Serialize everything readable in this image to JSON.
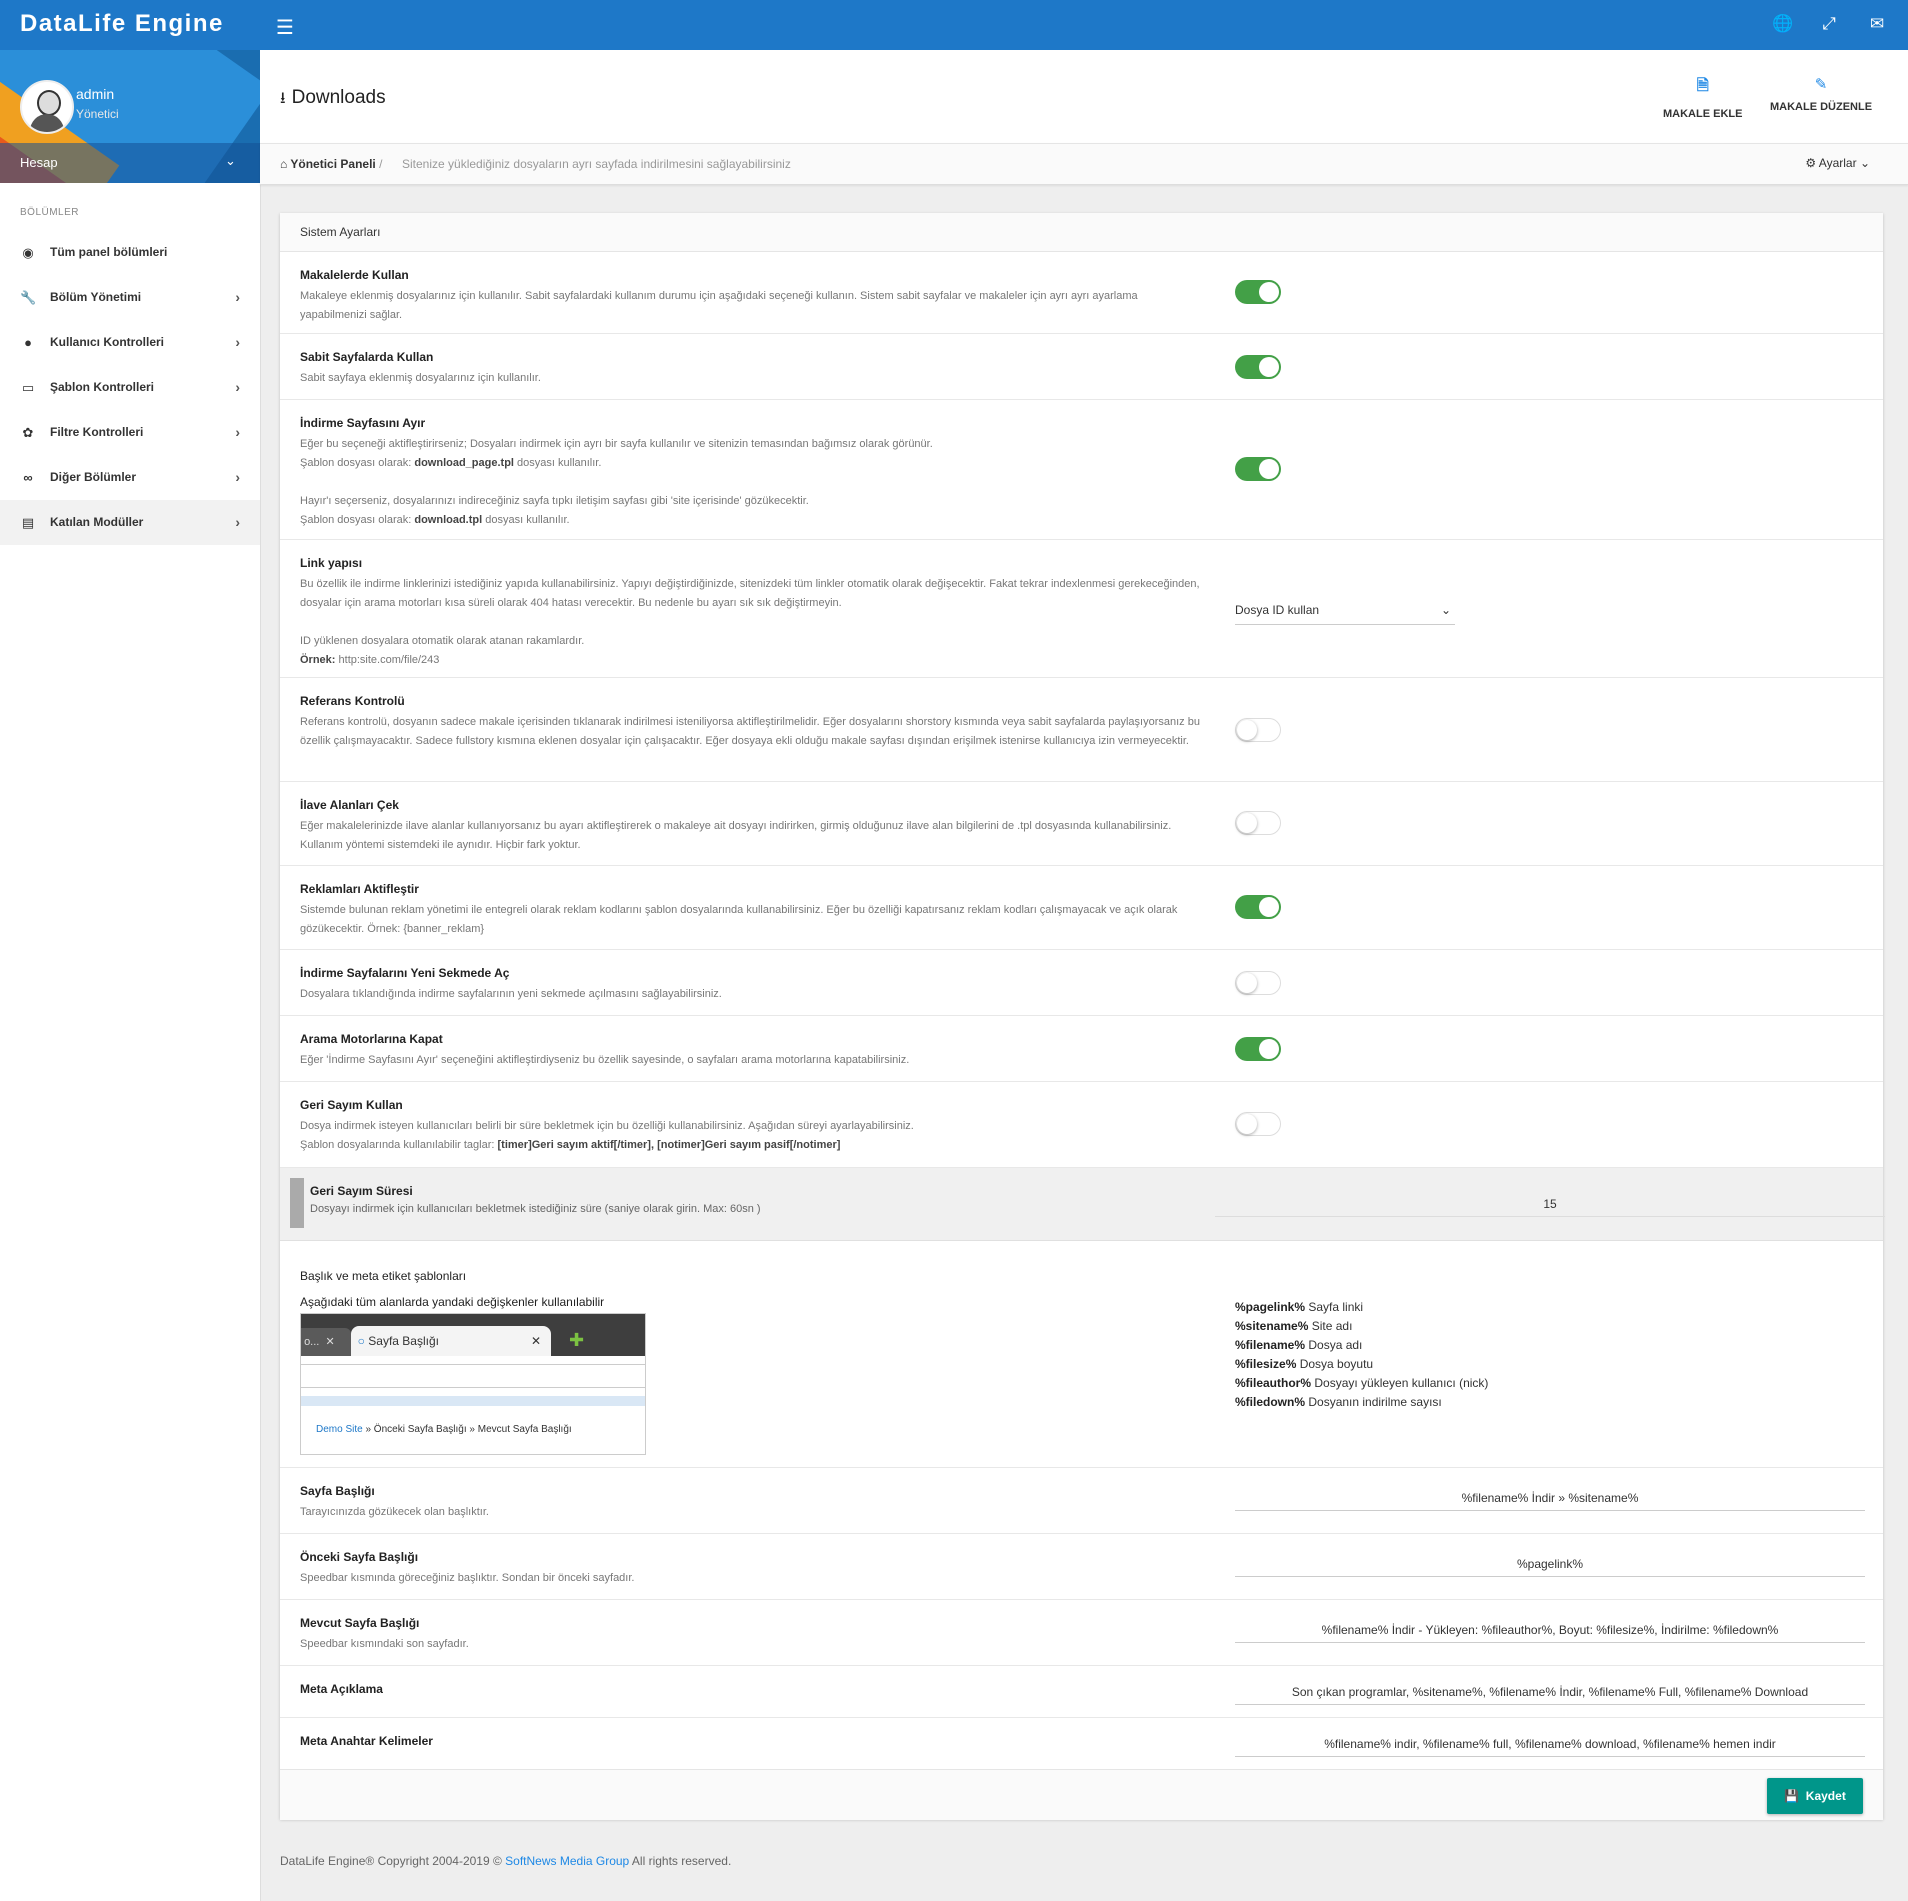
{
  "app": {
    "brand": "DataLife Engine"
  },
  "topbar_icons": [
    "globe-icon",
    "expand-icon",
    "mail-icon"
  ],
  "user": {
    "name": "admin",
    "role": "Yönetici",
    "account_label": "Hesap"
  },
  "sidebar": {
    "section_title": "BÖLÜMLER",
    "items": [
      {
        "label": "Tüm panel bölümleri",
        "icon": "globe-icon"
      },
      {
        "label": "Bölüm Yönetimi",
        "icon": "wrench-icon"
      },
      {
        "label": "Kullanıcı Kontrolleri",
        "icon": "user-icon"
      },
      {
        "label": "Şablon Kontrolleri",
        "icon": "laptop-icon"
      },
      {
        "label": "Filtre Kontrolleri",
        "icon": "leaf-icon"
      },
      {
        "label": "Diğer Bölümler",
        "icon": "link-icon"
      },
      {
        "label": "Katılan Modüller",
        "icon": "list-icon"
      }
    ]
  },
  "header": {
    "title": "Downloads",
    "btn_add": "MAKALE EKLE",
    "btn_edit": "MAKALE DÜZENLE"
  },
  "breadcrumb": {
    "home": "Yönetici Paneli",
    "sep": "/",
    "desc": "Sitenize yüklediğiniz dosyaların ayrı sayfada indirilmesini sağlayabilirsiniz",
    "settings": "Ayarlar"
  },
  "panel": {
    "title": "Sistem Ayarları"
  },
  "settings": {
    "s1": {
      "title": "Makalelerde Kullan",
      "d1": "Makaleye eklenmiş dosyalarınız için kullanılır. Sabit sayfalardaki kullanım durumu için aşağıdaki seçeneği kullanın. Sistem sabit sayfalar ve makaleler için ayrı ayrı ayarlama yapabilmenizi sağlar.",
      "on": true
    },
    "s2": {
      "title": "Sabit Sayfalarda Kullan",
      "d1": "Sabit sayfaya eklenmiş dosyalarınız için kullanılır.",
      "on": true
    },
    "s3": {
      "title": "İndirme Sayfasını Ayır",
      "d1": "Eğer bu seçeneği aktifleştirirseniz; Dosyaları indirmek için ayrı bir sayfa kullanılır ve sitenizin temasından bağımsız olarak görünür.",
      "d2a": "Şablon dosyası olarak: ",
      "d2b": "download_page.tpl",
      "d2c": " dosyası kullanılır.",
      "d3": "Hayır'ı seçerseniz, dosyalarınızı indireceğiniz sayfa tıpkı iletişim sayfası gibi 'site içerisinde' gözükecektir.",
      "d4a": "Şablon dosyası olarak: ",
      "d4b": "download.tpl",
      "d4c": " dosyası kullanılır.",
      "on": true
    },
    "s4": {
      "title": "Link yapısı",
      "d1": "Bu özellik ile indirme linklerinizi istediğiniz yapıda kullanabilirsiniz. Yapıyı değiştirdiğinizde, sitenizdeki tüm linkler otomatik olarak değişecektir. Fakat tekrar indexlenmesi gerekeceğinden, dosyalar için arama motorları kısa süreli olarak 404 hatası verecektir. Bu nedenle bu ayarı sık sık değiştirmeyin.",
      "d2": "ID yüklenen dosyalara otomatik olarak atanan rakamlardır.",
      "d3a": "Örnek:",
      "d3b": " http:site.com/file/243",
      "select": "Dosya ID kullan"
    },
    "s5": {
      "title": "Referans Kontrolü",
      "d1": "Referans kontrolü, dosyanın sadece makale içerisinden tıklanarak indirilmesi isteniliyorsa aktifleştirilmelidir. Eğer dosyalarını shorstory kısmında veya sabit sayfalarda paylaşıyorsanız bu özellik çalışmayacaktır. Sadece fullstory kısmına eklenen dosyalar için çalışacaktır. Eğer dosyaya ekli olduğu makale sayfası dışından erişilmek istenirse kullanıcıya izin vermeyecektir.",
      "on": false
    },
    "s6": {
      "title": "İlave Alanları Çek",
      "d1": "Eğer makalelerinizde ilave alanlar kullanıyorsanız bu ayarı aktifleştirerek o makaleye ait dosyayı indirirken, girmiş olduğunuz ilave alan bilgilerini de .tpl dosyasında kullanabilirsiniz. Kullanım yöntemi sistemdeki ile aynıdır. Hiçbir fark yoktur.",
      "on": false
    },
    "s7": {
      "title": "Reklamları Aktifleştir",
      "d1": "Sistemde bulunan reklam yönetimi ile entegreli olarak reklam kodlarını şablon dosyalarında kullanabilirsiniz. Eğer bu özelliği kapatırsanız reklam kodları çalışmayacak ve açık olarak gözükecektir. Örnek: {banner_reklam}",
      "on": true
    },
    "s8": {
      "title": "İndirme Sayfalarını Yeni Sekmede Aç",
      "d1": "Dosyalara tıklandığında indirme sayfalarının yeni sekmede açılmasını sağlayabilirsiniz.",
      "on": false
    },
    "s9": {
      "title": "Arama Motorlarına Kapat",
      "d1": "Eğer 'İndirme Sayfasını Ayır' seçeneğini aktifleştirdiyseniz bu özellik sayesinde, o sayfaları arama motorlarına kapatabilirsiniz.",
      "on": true
    },
    "s10": {
      "title": "Geri Sayım Kullan",
      "d1": "Dosya indirmek isteyen kullanıcıları belirli bir süre bekletmek için bu özelliği kullanabilirsiniz. Aşağıdan süreyi ayarlayabilirsiniz.",
      "d2a": "Şablon dosyalarında kullanılabilir taglar: ",
      "d2b": "[timer]Geri sayım aktif[/timer], [notimer]Geri sayım pasif[/notimer]",
      "on": false
    },
    "s11": {
      "title": "Geri Sayım Süresi",
      "d1": "Dosyayı indirmek için kullanıcıları bekletmek istediğiniz süre (saniye olarak girin. Max: 60sn )",
      "value": "15"
    }
  },
  "meta": {
    "title": "Başlık ve meta etiket şablonları",
    "subtitle": "Aşağıdaki tüm alanlarda yandaki değişkenler kullanılabilir",
    "browser": {
      "tab1": "o...",
      "tab1_close": "✕",
      "tab2": "Sayfa Başlığı",
      "tab2_close": "✕",
      "crumb_link": "Demo Site",
      "crumb_rest": " » Önceki Sayfa Başlığı » Mevcut Sayfa Başlığı"
    },
    "vars": [
      {
        "k": "%pagelink%",
        "v": " Sayfa linki"
      },
      {
        "k": "%sitename%",
        "v": " Site adı"
      },
      {
        "k": "%filename%",
        "v": " Dosya adı"
      },
      {
        "k": "%filesize%",
        "v": " Dosya boyutu"
      },
      {
        "k": "%fileauthor%",
        "v": " Dosyayı yükleyen kullanıcı (nick)"
      },
      {
        "k": "%filedown%",
        "v": " Dosyanın indirilme sayısı"
      }
    ],
    "f1": {
      "title": "Sayfa Başlığı",
      "d": "Tarayıcınızda gözükecek olan başlıktır.",
      "value": "%filename% İndir » %sitename%"
    },
    "f2": {
      "title": "Önceki Sayfa Başlığı",
      "d": "Speedbar kısmında göreceğiniz başlıktır. Sondan bir önceki sayfadır.",
      "value": "%pagelink%"
    },
    "f3": {
      "title": "Mevcut Sayfa Başlığı",
      "d": "Speedbar kısmındaki son sayfadır.",
      "value": "%filename% İndir - Yükleyen: %fileauthor%, Boyut: %filesize%, İndirilme: %filedown%"
    },
    "f4": {
      "title": "Meta Açıklama",
      "value": "Son çıkan programlar, %sitename%, %filename% İndir, %filename% Full, %filename% Download"
    },
    "f5": {
      "title": "Meta Anahtar Kelimeler",
      "value": "%filename% indir, %filename% full, %filename% download, %filename% hemen indir"
    }
  },
  "save_label": "Kaydet",
  "footer": {
    "pre": "DataLife Engine® Copyright 2004-2019 © ",
    "link": "SoftNews Media Group",
    "post": " All rights reserved."
  }
}
